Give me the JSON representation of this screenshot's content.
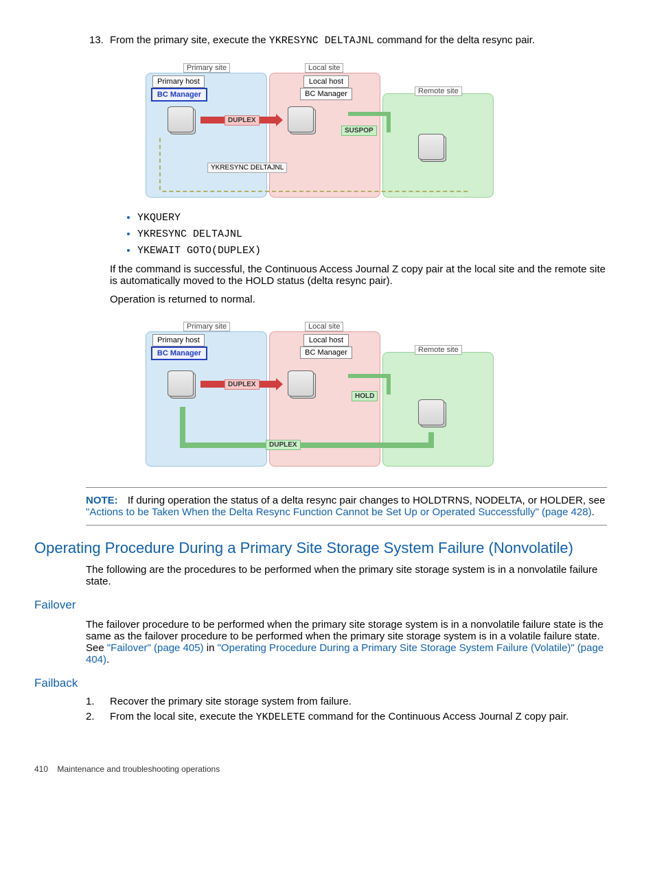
{
  "step13": {
    "num": "13.",
    "prefix": "From the primary site, execute the ",
    "cmd": "YKRESYNC DELTAJNL",
    "suffix": " command for the delta resync pair."
  },
  "diagram1": {
    "primary_site": "Primary site",
    "primary_host": "Primary host",
    "bc_manager": "BC Manager",
    "local_site": "Local site",
    "local_host": "Local host",
    "remote_site": "Remote site",
    "duplex": "DUPLEX",
    "suspop": "SUSPOP",
    "ykresync": "YKRESYNC DELTAJNL"
  },
  "cmds": {
    "a": "YKQUERY",
    "b": "YKRESYNC DELTAJNL",
    "c": "YKEWAIT GOTO(DUPLEX)"
  },
  "para1": "If the command is successful, the Continuous Access Journal Z copy pair at the local site and the remote site is automatically moved to the HOLD status (delta resync pair).",
  "para2": "Operation is returned to normal.",
  "diagram2": {
    "primary_site": "Primary site",
    "primary_host": "Primary host",
    "bc_manager": "BC Manager",
    "local_site": "Local site",
    "local_host": "Local host",
    "remote_site": "Remote site",
    "duplex": "DUPLEX",
    "hold": "HOLD",
    "duplex2": "DUPLEX"
  },
  "note": {
    "label": "NOTE:",
    "t1": "If during operation the status of a delta resync pair changes to HOLDTRNS, NODELTA, or HOLDER, see ",
    "link": "\"Actions to be Taken When the Delta Resync Function Cannot be Set Up or Operated Successfully\" (page 428)",
    "t2": "."
  },
  "h2": "Operating Procedure During a Primary Site Storage System Failure (Nonvolatile)",
  "h2_para": "The following are the procedures to be performed when the primary site storage system is in a nonvolatile failure state.",
  "failover": {
    "h": "Failover",
    "t1": "The failover procedure to be performed when the primary site storage system is in a nonvolatile failure state is the same as the failover procedure to be performed when the primary site storage system is in a volatile failure state. See ",
    "link1": "\"Failover\" (page 405)",
    "t2": " in ",
    "link2": "\"Operating Procedure During a Primary Site Storage System Failure (Volatile)\" (page 404)",
    "t3": "."
  },
  "failback": {
    "h": "Failback",
    "s1": {
      "n": "1.",
      "t": "Recover the primary site storage system from failure."
    },
    "s2": {
      "n": "2.",
      "t1": "From the local site, execute the ",
      "cmd": "YKDELETE",
      "t2": " command for the Continuous Access Journal Z copy pair."
    }
  },
  "footer": {
    "page": "410",
    "title": "Maintenance and troubleshooting operations"
  }
}
